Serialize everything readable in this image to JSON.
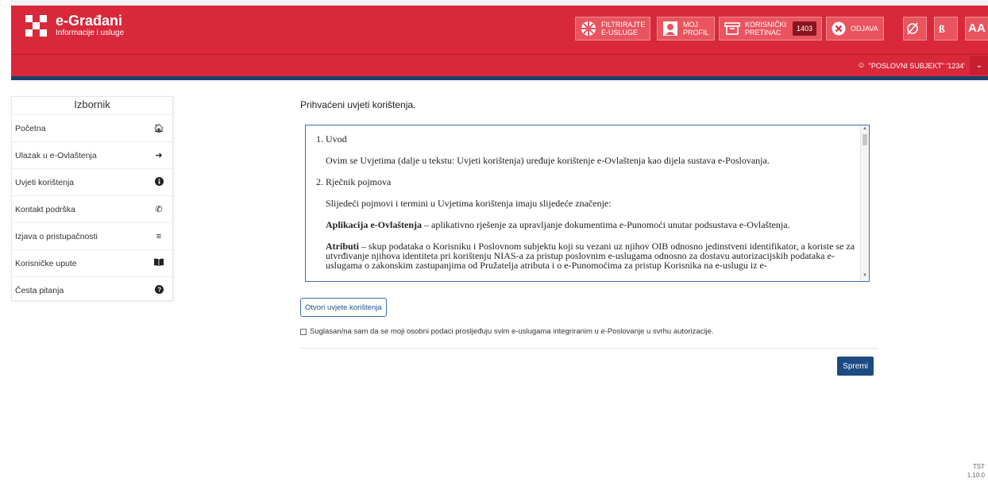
{
  "header": {
    "app_title": "e-Građani",
    "app_subtitle": "Informacije i usluge",
    "filter_line1": "FILTRIRAJTE",
    "filter_line2": "E-USLUGE",
    "profile_line1": "MOJ",
    "profile_line2": "PROFIL",
    "inbox_line1": "KORISNIČKI",
    "inbox_line2": "PRETINAC",
    "inbox_count": "1403",
    "logout_label": "ODJAVA",
    "font_size_label": "AA",
    "accent_color": "#d8283a"
  },
  "subbar": {
    "subject": "\"POSLOVNI SUBJEKT\" '1234'"
  },
  "sidebar": {
    "title": "Izbornik",
    "items": [
      {
        "label": "Početna",
        "icon": "home-icon"
      },
      {
        "label": "Ulazak u e-Ovlaštenja",
        "icon": "sign-in-icon"
      },
      {
        "label": "Uvjeti korištenja",
        "icon": "info-icon"
      },
      {
        "label": "Kontakt podrška",
        "icon": "phone-icon"
      },
      {
        "label": "Izjava o pristupačnosti",
        "icon": "accessibility-icon"
      },
      {
        "label": "Korisničke upute",
        "icon": "book-icon"
      },
      {
        "label": "Česta pitanja",
        "icon": "question-icon"
      }
    ]
  },
  "main": {
    "title": "Prihvaćeni uvjeti korištenja.",
    "terms": {
      "h1": "1. Uvod",
      "p1": "Ovim se Uvjetima (dalje u tekstu: Uvjeti korištenja) uređuje korištenje e-Ovlaštenja kao dijela sustava e-Poslovanja.",
      "h2": "2. Rječnik pojmova",
      "p2": "Slijedeći pojmovi i termini u Uvjetima korištenja imaju slijedeće značenje:",
      "term1": "Aplikacija e-Ovlaštenja",
      "def1": " – aplikativno rješenje za upravljanje dokumentima e-Punomoći unutar podsustava e-Ovlaštenja.",
      "term2": "Atributi",
      "def2": " – skup podataka o Korisniku i Poslovnom subjektu koji su vezani uz njihov OIB odnosno jedinstveni identifikator, a koriste se za utvrđivanje njihova identiteta pri korištenju NIAS-a za pristup poslovnim e-uslugama odnosno za dostavu autorizacijskih podataka e-uslugama o zakonskim zastupanjima od Pružatelja atributa i o e-Punomoćima za pristup Korisnika na e-uslugu iz e-"
    },
    "open_terms_label": "Otvori uvjete korištenja",
    "consent_label": "Suglasan/na sam da se moji osobni podaci prosljeđuju svim e-uslugama integriranim u e-Poslovanje u svrhu autorizacije.",
    "consent_checked": false,
    "save_label": "Spremi"
  },
  "footer": {
    "env": "TST",
    "version": "1.10.0"
  }
}
